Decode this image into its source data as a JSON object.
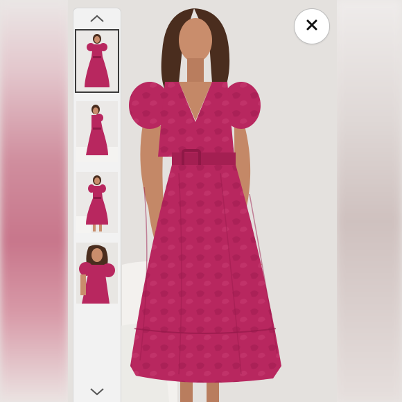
{
  "viewer": {
    "images": [
      {
        "icon": "dress-front-full-thumbnail",
        "selected": true
      },
      {
        "icon": "dress-side-full-thumbnail",
        "selected": false
      },
      {
        "icon": "dress-front-walk-thumbnail",
        "selected": false
      },
      {
        "icon": "dress-seated-closeup-thumbnail",
        "selected": false
      }
    ],
    "controls": {
      "scroll_up_icon": "chevron-up-icon",
      "scroll_down_icon": "chevron-down-icon",
      "close_icon": "close-icon"
    }
  },
  "colors": {
    "dress": "#b8275f",
    "dress_dark": "#8f1846",
    "skin": "#c98d6c",
    "hair": "#4a2d1e",
    "backdrop": "#e4e1de"
  }
}
